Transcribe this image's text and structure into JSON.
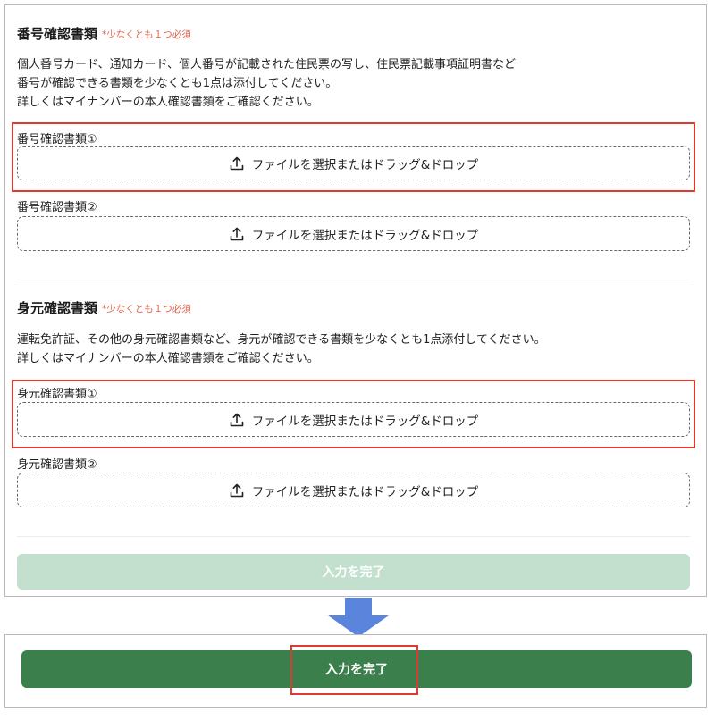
{
  "number_section": {
    "title": "番号確認書類",
    "required_note": "*少なくとも１つ必須",
    "description": [
      "個人番号カード、通知カード、個人番号が記載された住民票の写し、住民票記載事項証明書など",
      "番号が確認できる書類を少なくとも1点は添付してください。",
      "詳しくはマイナンバーの本人確認書類をご確認ください。"
    ],
    "fields": [
      {
        "label": "番号確認書類①",
        "dropzone_text": "ファイルを選択またはドラッグ&ドロップ"
      },
      {
        "label": "番号確認書類②",
        "dropzone_text": "ファイルを選択またはドラッグ&ドロップ"
      }
    ]
  },
  "identity_section": {
    "title": "身元確認書類",
    "required_note": "*少なくとも１つ必須",
    "description": [
      "運転免許証、その他の身元確認書類など、身元が確認できる書類を少なくとも1点添付してください。",
      "詳しくはマイナンバーの本人確認書類をご確認ください。"
    ],
    "fields": [
      {
        "label": "身元確認書類①",
        "dropzone_text": "ファイルを選択またはドラッグ&ドロップ"
      },
      {
        "label": "身元確認書類②",
        "dropzone_text": "ファイルを選択またはドラッグ&ドロップ"
      }
    ]
  },
  "submit_disabled": {
    "label": "入力を完了"
  },
  "submit_active": {
    "label": "入力を完了"
  },
  "colors": {
    "highlight": "#e03a30",
    "required_note": "#e0624a",
    "button_disabled": "#c3dfcd",
    "button_active": "#3b804c",
    "arrow": "#5b84dd"
  },
  "icons": {
    "dropzone": "upload-icon",
    "transition": "arrow-down-icon"
  }
}
